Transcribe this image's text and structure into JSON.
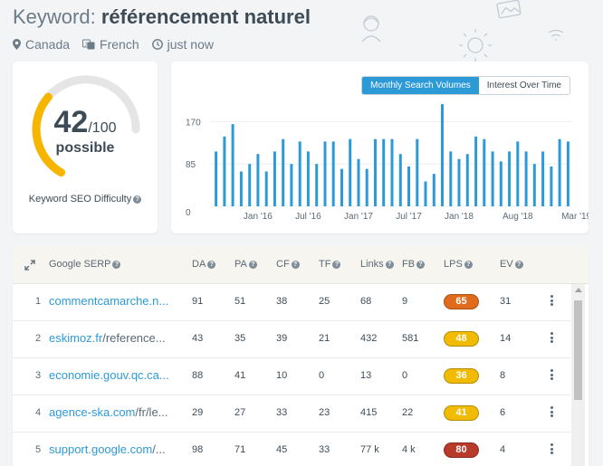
{
  "header": {
    "keyword_label": "Keyword:",
    "keyword_value": "référencement naturel",
    "location": "Canada",
    "language": "French",
    "updated": "just now",
    "icons": [
      "location-pin-icon",
      "language-icon",
      "clock-icon"
    ]
  },
  "difficulty": {
    "score": "42",
    "out_of": "/100",
    "level": "possible",
    "label": "Keyword SEO Difficulty",
    "value": 42,
    "colors": {
      "accent": "#f7b500",
      "track": "#e5e5e5"
    }
  },
  "chart_tabs": [
    {
      "label": "Monthly Search Volumes",
      "active": true
    },
    {
      "label": "Interest Over Time",
      "active": false
    }
  ],
  "chart_data": {
    "type": "bar",
    "title": "",
    "xlabel": "",
    "ylabel": "",
    "ylim": [
      0,
      170
    ],
    "y_ticks": [
      "0",
      "85",
      "170"
    ],
    "x_tick_labels": [
      "Jan '16",
      "Jul '16",
      "Jan '17",
      "Jul '17",
      "Jan '18",
      "Aug '18",
      "Mar '19"
    ],
    "x_tick_indices": [
      5,
      11,
      17,
      23,
      29,
      36,
      43
    ],
    "values": [
      110,
      140,
      165,
      70,
      85,
      105,
      70,
      110,
      135,
      85,
      130,
      110,
      85,
      130,
      130,
      75,
      135,
      95,
      75,
      135,
      135,
      135,
      105,
      80,
      135,
      50,
      65,
      205,
      110,
      95,
      105,
      140,
      135,
      110,
      90,
      110,
      130,
      110,
      85,
      110,
      80,
      135,
      130
    ],
    "color": "#2d9ad8"
  },
  "table": {
    "headers": [
      "Google SERP",
      "DA",
      "PA",
      "CF",
      "TF",
      "Links",
      "FB",
      "LPS",
      "EV"
    ],
    "rows": [
      {
        "rank": "1",
        "domain": "commentcamarche.n...",
        "path": "",
        "da": "91",
        "pa": "51",
        "cf": "38",
        "tf": "25",
        "links": "68",
        "fb": "9",
        "lps": "65",
        "lps_color": "#e06b1c",
        "ev": "31"
      },
      {
        "rank": "2",
        "domain": "eskimoz.fr",
        "path": "/reference...",
        "da": "43",
        "pa": "35",
        "cf": "39",
        "tf": "21",
        "links": "432",
        "fb": "581",
        "lps": "48",
        "lps_color": "#f0bb00",
        "ev": "14"
      },
      {
        "rank": "3",
        "domain": "economie.gouv.qc.ca...",
        "path": "",
        "da": "88",
        "pa": "41",
        "cf": "10",
        "tf": "0",
        "links": "13",
        "fb": "0",
        "lps": "36",
        "lps_color": "#f0bb00",
        "ev": "8"
      },
      {
        "rank": "4",
        "domain": "agence-ska.com",
        "path": "/fr/le...",
        "da": "29",
        "pa": "27",
        "cf": "33",
        "tf": "23",
        "links": "415",
        "fb": "22",
        "lps": "41",
        "lps_color": "#f0bb00",
        "ev": "6"
      },
      {
        "rank": "5",
        "domain": "support.google.com",
        "path": "/...",
        "da": "98",
        "pa": "71",
        "cf": "45",
        "tf": "33",
        "links": "77 k",
        "fb": "4 k",
        "lps": "80",
        "lps_color": "#b83a2a",
        "ev": "4"
      }
    ]
  }
}
